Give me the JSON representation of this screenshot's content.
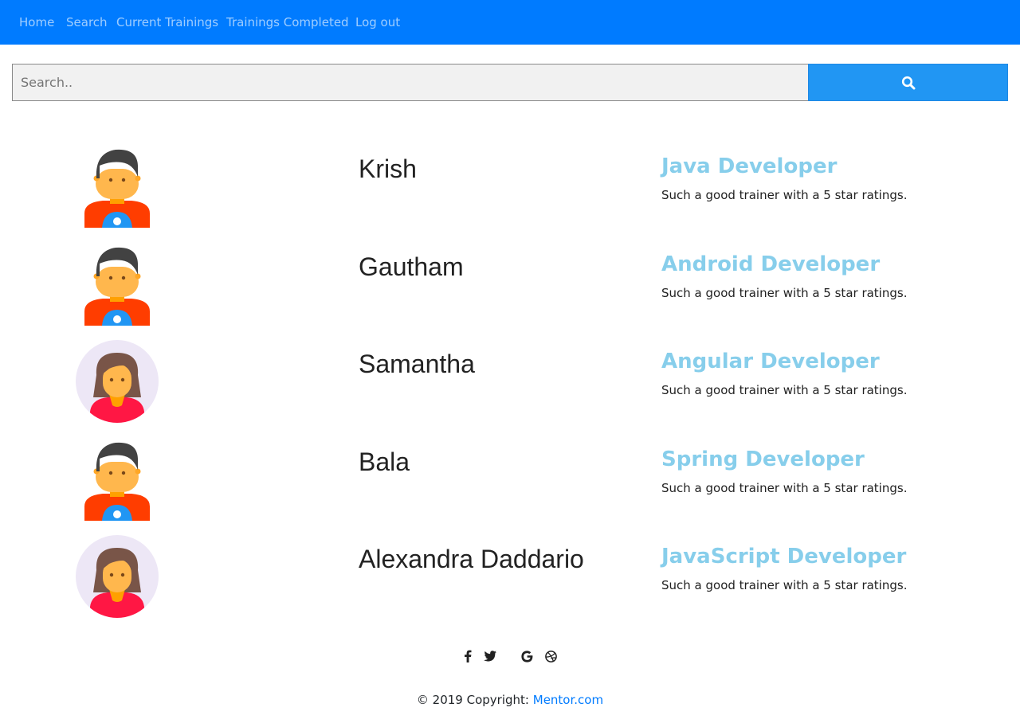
{
  "nav": {
    "items": [
      {
        "label": "Home"
      },
      {
        "label": "Search"
      },
      {
        "label": "Current Trainings"
      },
      {
        "label": "Trainings Completed"
      },
      {
        "label": "Log out"
      }
    ]
  },
  "search": {
    "placeholder": "Search..",
    "button_icon": "search-icon"
  },
  "trainers": [
    {
      "name": "Krish",
      "title": "Java Developer",
      "description": "Such a good trainer with a 5 star ratings.",
      "avatar": "male-avatar-icon"
    },
    {
      "name": "Gautham",
      "title": "Android Developer",
      "description": "Such a good trainer with a 5 star ratings.",
      "avatar": "male-avatar-icon"
    },
    {
      "name": "Samantha",
      "title": "Angular Developer",
      "description": "Such a good trainer with a 5 star ratings.",
      "avatar": "female-avatar-icon"
    },
    {
      "name": "Bala",
      "title": "Spring Developer",
      "description": "Such a good trainer with a 5 star ratings.",
      "avatar": "male-avatar-icon"
    },
    {
      "name": "Alexandra Daddario",
      "title": "JavaScript Developer",
      "description": "Such a good trainer with a 5 star ratings.",
      "avatar": "female-avatar-icon"
    }
  ],
  "social": [
    "facebook-icon",
    "twitter-icon",
    "google-icon",
    "dribbble-icon"
  ],
  "footer": {
    "copyright": "© 2019 Copyright:",
    "link_text": "Mentor.com"
  },
  "colors": {
    "navbar": "#007bff",
    "search_button": "#2196f3",
    "title": "#87ceeb",
    "link": "#007bff"
  }
}
